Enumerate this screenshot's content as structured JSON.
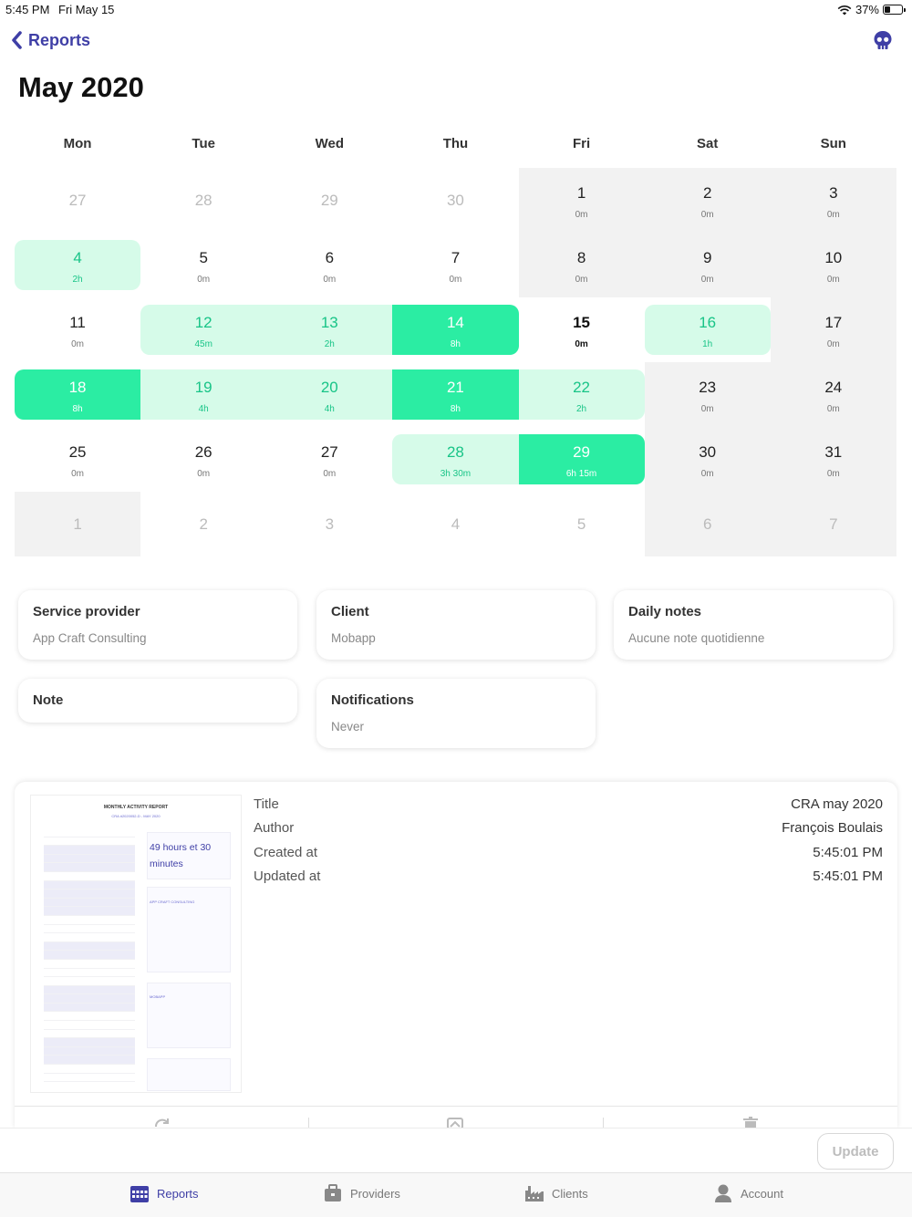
{
  "status_bar": {
    "time": "5:45 PM",
    "date": "Fri May 15",
    "battery": "37%"
  },
  "nav": {
    "back_label": "Reports"
  },
  "calendar": {
    "title": "May 2020",
    "weekdays": [
      "Mon",
      "Tue",
      "Wed",
      "Thu",
      "Fri",
      "Sat",
      "Sun"
    ],
    "weeks": [
      [
        {
          "day": "27",
          "dur": "",
          "other": true
        },
        {
          "day": "28",
          "dur": "",
          "other": true
        },
        {
          "day": "29",
          "dur": "",
          "other": true
        },
        {
          "day": "30",
          "dur": "",
          "other": true
        },
        {
          "day": "1",
          "dur": "0m",
          "bg": true
        },
        {
          "day": "2",
          "dur": "0m",
          "bg": true
        },
        {
          "day": "3",
          "dur": "0m",
          "bg": true
        }
      ],
      [
        {
          "day": "4",
          "dur": "2h",
          "hl": "light",
          "rl": true,
          "rr": true
        },
        {
          "day": "5",
          "dur": "0m"
        },
        {
          "day": "6",
          "dur": "0m"
        },
        {
          "day": "7",
          "dur": "0m"
        },
        {
          "day": "8",
          "dur": "0m",
          "bg": true
        },
        {
          "day": "9",
          "dur": "0m",
          "bg": true
        },
        {
          "day": "10",
          "dur": "0m",
          "bg": true
        }
      ],
      [
        {
          "day": "11",
          "dur": "0m"
        },
        {
          "day": "12",
          "dur": "45m",
          "hl": "light",
          "rl": true
        },
        {
          "day": "13",
          "dur": "2h",
          "hl": "light"
        },
        {
          "day": "14",
          "dur": "8h",
          "hl": "dark",
          "rr": true
        },
        {
          "day": "15",
          "dur": "0m",
          "today": true
        },
        {
          "day": "16",
          "dur": "1h",
          "hl": "light",
          "rl": true,
          "rr": true
        },
        {
          "day": "17",
          "dur": "0m",
          "bg": true
        }
      ],
      [
        {
          "day": "18",
          "dur": "8h",
          "hl": "dark",
          "rl": true
        },
        {
          "day": "19",
          "dur": "4h",
          "hl": "light"
        },
        {
          "day": "20",
          "dur": "4h",
          "hl": "light"
        },
        {
          "day": "21",
          "dur": "8h",
          "hl": "dark"
        },
        {
          "day": "22",
          "dur": "2h",
          "hl": "light",
          "rr": true
        },
        {
          "day": "23",
          "dur": "0m",
          "bg": true
        },
        {
          "day": "24",
          "dur": "0m",
          "bg": true
        }
      ],
      [
        {
          "day": "25",
          "dur": "0m"
        },
        {
          "day": "26",
          "dur": "0m"
        },
        {
          "day": "27",
          "dur": "0m"
        },
        {
          "day": "28",
          "dur": "3h 30m",
          "hl": "light",
          "rl": true
        },
        {
          "day": "29",
          "dur": "6h 15m",
          "hl": "dark",
          "rr": true
        },
        {
          "day": "30",
          "dur": "0m",
          "bg": true
        },
        {
          "day": "31",
          "dur": "0m",
          "bg": true
        }
      ],
      [
        {
          "day": "1",
          "dur": "",
          "other": true,
          "bg": true
        },
        {
          "day": "2",
          "dur": "",
          "other": true
        },
        {
          "day": "3",
          "dur": "",
          "other": true
        },
        {
          "day": "4",
          "dur": "",
          "other": true
        },
        {
          "day": "5",
          "dur": "",
          "other": true
        },
        {
          "day": "6",
          "dur": "",
          "other": true,
          "bg": true
        },
        {
          "day": "7",
          "dur": "",
          "other": true,
          "bg": true
        }
      ]
    ],
    "colors": {
      "light": "#d6fbe9",
      "dark": "#2beda3",
      "text_green": "#18c487"
    }
  },
  "cards": {
    "service_provider": {
      "title": "Service provider",
      "value": "App Craft Consulting"
    },
    "client": {
      "title": "Client",
      "value": "Mobapp"
    },
    "daily_notes": {
      "title": "Daily notes",
      "value": "Aucune note quotidienne"
    },
    "note": {
      "title": "Note"
    },
    "notifications": {
      "title": "Notifications",
      "value": "Never"
    }
  },
  "document": {
    "thumbnail": {
      "heading": "MONTHLY ACTIVITY REPORT",
      "subheading": "CRA #2020052-D - MAY 2020",
      "total": "49 hours et 30 minutes",
      "provider": "APP CRAFT CONSULTING",
      "client": "MOBAPP"
    },
    "meta": [
      {
        "label": "Title",
        "value": "CRA may 2020"
      },
      {
        "label": "Author",
        "value": "François Boulais"
      },
      {
        "label": "Created at",
        "value": "5:45:01 PM"
      },
      {
        "label": "Updated at",
        "value": "5:45:01 PM"
      }
    ]
  },
  "actions": {
    "update_label": "Update"
  },
  "tabbar": {
    "items": [
      {
        "label": "Reports",
        "icon": "calendar-icon",
        "active": true
      },
      {
        "label": "Providers",
        "icon": "briefcase-icon"
      },
      {
        "label": "Clients",
        "icon": "factory-icon"
      },
      {
        "label": "Account",
        "icon": "user-icon"
      }
    ],
    "accent": "#3f3fa6"
  }
}
